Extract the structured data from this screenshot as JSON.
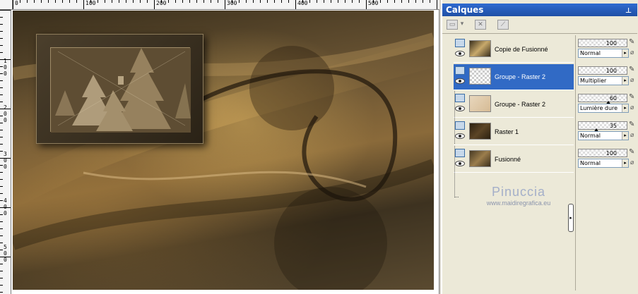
{
  "rulers": {
    "top_labels": [
      "0",
      "100",
      "200",
      "300",
      "400",
      "500"
    ],
    "left_labels": [
      "1\n0\n0",
      "2\n0\n0",
      "3\n0\n0",
      "4\n0\n0",
      "5\n0\n0"
    ]
  },
  "panel": {
    "title": "Calques",
    "pin_icon": "pin-icon"
  },
  "toolbar": {
    "new_layer_icon": "new-layer-icon",
    "delete_layer_icon": "delete-layer-icon",
    "edit_mask_icon": "mask-icon"
  },
  "layers": [
    {
      "name": "Copie de Fusionné",
      "thumb": "copy",
      "selected": false,
      "opacity": "100",
      "blend": "Normal"
    },
    {
      "name": "Groupe - Raster 2",
      "thumb": "checker",
      "selected": true,
      "opacity": "100",
      "blend": "Multiplier"
    },
    {
      "name": "Groupe - Raster 2",
      "thumb": "beige",
      "selected": false,
      "opacity": "60",
      "blend": "Lumière dure"
    },
    {
      "name": "Raster 1",
      "thumb": "dark",
      "selected": false,
      "opacity": "35",
      "blend": "Normal"
    },
    {
      "name": "Fusionné",
      "thumb": "photo",
      "selected": false,
      "opacity": "100",
      "blend": "Normal"
    }
  ],
  "watermark": {
    "name": "Pinuccia",
    "url": "www.maidiregrafica.eu"
  },
  "colors": {
    "title_bar": "#2f6bd0",
    "selection": "#316ac5",
    "panel_bg": "#ece9d8"
  }
}
